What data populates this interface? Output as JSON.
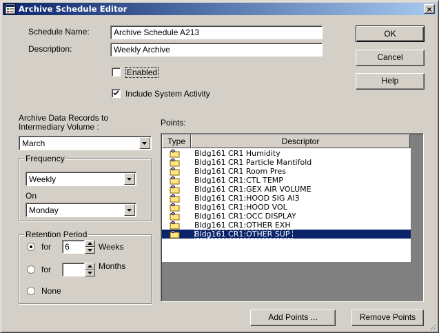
{
  "window": {
    "title": "Archive Schedule Editor",
    "close_glyph": "×",
    "icon": "archive-schedule-app-icon"
  },
  "form": {
    "schedule_name_label": "Schedule Name:",
    "schedule_name_value": "Archive Schedule A213",
    "description_label": "Description:",
    "description_value": "Weekly Archive",
    "enabled_label": "Enabled",
    "enabled_checked": false,
    "include_system_label": "Include System Activity",
    "include_system_checked": true
  },
  "buttons": {
    "ok": "OK",
    "cancel": "Cancel",
    "help": "Help",
    "add_points": "Add Points ...",
    "remove_points": "Remove Points"
  },
  "archive": {
    "label_line1": "Archive Data Records to",
    "label_line2": "Intermediary Volume :",
    "volume_value": "March"
  },
  "frequency": {
    "group_title": "Frequency",
    "value": "Weekly",
    "on_label": "On",
    "on_value": "Monday"
  },
  "retention": {
    "group_title": "Retention Period",
    "selected": "for-weeks",
    "for_label": "for",
    "weeks_value": "6",
    "weeks_unit": "Weeks",
    "months_value": "",
    "months_unit": "Months",
    "none_label": "None"
  },
  "points": {
    "label": "Points:",
    "columns": [
      "Type",
      "Descriptor"
    ],
    "rows": [
      "Bldg161 CR1 Humidity",
      "Bldg161 CR1 Particle Mantifold",
      "Bldg161 CR1 Room Pres",
      "Bldg161 CR1:CTL TEMP",
      "Bldg161 CR1:GEX AIR VOLUME",
      "Bldg161 CR1:HOOD SIG AI3",
      "Bldg161 CR1:HOOD VOL",
      "Bldg161 CR1:OCC DISPLAY",
      "Bldg161 CR1:OTHER EXH",
      "Bldg161 CR1:OTHER SUP"
    ],
    "selected_index": 9,
    "row_icon": "point-folder-icon"
  },
  "colors": {
    "face": "#d4d0c8",
    "title_start": "#0a246a",
    "title_end": "#a6caf0",
    "selection": "#0a246a",
    "list_empty": "#808080",
    "folder": "#ffe680"
  }
}
